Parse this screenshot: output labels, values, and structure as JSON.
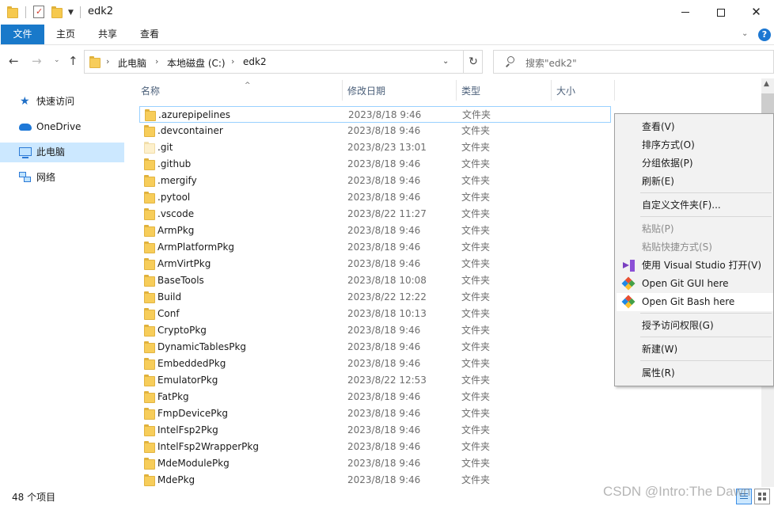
{
  "window": {
    "title": "edk2",
    "minimize_glyph": "",
    "close_glyph": "✕"
  },
  "ribbon": {
    "tabs": [
      "文件",
      "主页",
      "共享",
      "查看"
    ],
    "help_glyph": "?"
  },
  "address": {
    "crumbs": [
      "此电脑",
      "本地磁盘 (C:)",
      "edk2"
    ],
    "search_placeholder": "搜索\"edk2\""
  },
  "nav_pane": {
    "items": [
      "快速访问",
      "OneDrive",
      "此电脑",
      "网络"
    ],
    "selected": "此电脑"
  },
  "columns": {
    "name": "名称",
    "date": "修改日期",
    "type": "类型",
    "size": "大小"
  },
  "files": [
    {
      "name": ".azurepipelines",
      "date": "2023/8/18 9:46",
      "type": "文件夹"
    },
    {
      "name": ".devcontainer",
      "date": "2023/8/18 9:46",
      "type": "文件夹"
    },
    {
      "name": ".git",
      "date": "2023/8/23 13:01",
      "type": "文件夹"
    },
    {
      "name": ".github",
      "date": "2023/8/18 9:46",
      "type": "文件夹"
    },
    {
      "name": ".mergify",
      "date": "2023/8/18 9:46",
      "type": "文件夹"
    },
    {
      "name": ".pytool",
      "date": "2023/8/18 9:46",
      "type": "文件夹"
    },
    {
      "name": ".vscode",
      "date": "2023/8/22 11:27",
      "type": "文件夹"
    },
    {
      "name": "ArmPkg",
      "date": "2023/8/18 9:46",
      "type": "文件夹"
    },
    {
      "name": "ArmPlatformPkg",
      "date": "2023/8/18 9:46",
      "type": "文件夹"
    },
    {
      "name": "ArmVirtPkg",
      "date": "2023/8/18 9:46",
      "type": "文件夹"
    },
    {
      "name": "BaseTools",
      "date": "2023/8/18 10:08",
      "type": "文件夹"
    },
    {
      "name": "Build",
      "date": "2023/8/22 12:22",
      "type": "文件夹"
    },
    {
      "name": "Conf",
      "date": "2023/8/18 10:13",
      "type": "文件夹"
    },
    {
      "name": "CryptoPkg",
      "date": "2023/8/18 9:46",
      "type": "文件夹"
    },
    {
      "name": "DynamicTablesPkg",
      "date": "2023/8/18 9:46",
      "type": "文件夹"
    },
    {
      "name": "EmbeddedPkg",
      "date": "2023/8/18 9:46",
      "type": "文件夹"
    },
    {
      "name": "EmulatorPkg",
      "date": "2023/8/22 12:53",
      "type": "文件夹"
    },
    {
      "name": "FatPkg",
      "date": "2023/8/18 9:46",
      "type": "文件夹"
    },
    {
      "name": "FmpDevicePkg",
      "date": "2023/8/18 9:46",
      "type": "文件夹"
    },
    {
      "name": "IntelFsp2Pkg",
      "date": "2023/8/18 9:46",
      "type": "文件夹"
    },
    {
      "name": "IntelFsp2WrapperPkg",
      "date": "2023/8/18 9:46",
      "type": "文件夹"
    },
    {
      "name": "MdeModulePkg",
      "date": "2023/8/18 9:46",
      "type": "文件夹"
    },
    {
      "name": "MdePkg",
      "date": "2023/8/18 9:46",
      "type": "文件夹"
    }
  ],
  "status": {
    "item_count": "48 个项目"
  },
  "watermark": "CSDN @Intro:The Dawn",
  "context_menu": {
    "items": [
      {
        "label": "查看(V)",
        "icon": "",
        "disabled": false
      },
      {
        "label": "排序方式(O)",
        "icon": "",
        "disabled": false
      },
      {
        "label": "分组依据(P)",
        "icon": "",
        "disabled": false
      },
      {
        "label": "刷新(E)",
        "icon": "",
        "disabled": false
      },
      {
        "label": "自定义文件夹(F)...",
        "icon": "",
        "disabled": false
      },
      {
        "label": "粘贴(P)",
        "icon": "",
        "disabled": true
      },
      {
        "label": "粘贴快捷方式(S)",
        "icon": "",
        "disabled": true
      },
      {
        "label": "使用 Visual Studio 打开(V)",
        "icon": "visual-studio-icon",
        "disabled": false
      },
      {
        "label": "Open Git GUI here",
        "icon": "git-icon",
        "disabled": false
      },
      {
        "label": "Open Git Bash here",
        "icon": "git-icon",
        "disabled": false
      },
      {
        "label": "授予访问权限(G)",
        "icon": "",
        "disabled": false
      },
      {
        "label": "新建(W)",
        "icon": "",
        "disabled": false
      },
      {
        "label": "属性(R)",
        "icon": "",
        "disabled": false
      }
    ],
    "hovered": "Open Git Bash here"
  }
}
